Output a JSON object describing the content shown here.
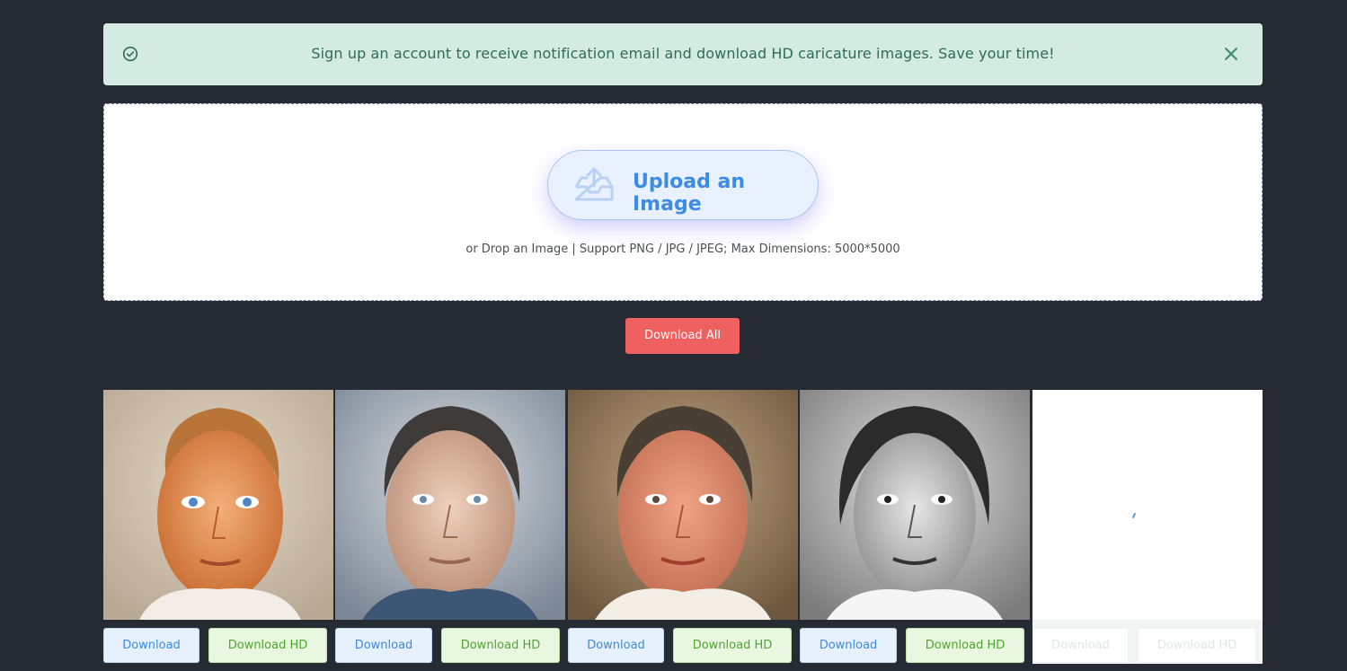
{
  "alert": {
    "message": "Sign up an account to receive notification email and download HD caricature images. Save your time!"
  },
  "upload": {
    "button_label": "Upload an Image",
    "hint": "or Drop an Image | Support PNG / JPG / JPEG; Max Dimensions: 5000*5000"
  },
  "actions": {
    "download_all_label": "Download All"
  },
  "results": [
    {
      "download_label": "Download",
      "download_hd_label": "Download HD",
      "style": "warm-color"
    },
    {
      "download_label": "Download",
      "download_hd_label": "Download HD",
      "style": "cool-blue"
    },
    {
      "download_label": "Download",
      "download_hd_label": "Download HD",
      "style": "sepia-warm"
    },
    {
      "download_label": "Download",
      "download_hd_label": "Download HD",
      "style": "grayscale-sketch"
    },
    {
      "download_label": "Download",
      "download_hd_label": "Download HD",
      "style": "loading"
    }
  ],
  "colors": {
    "background": "#252a33",
    "alert_bg": "#d3ebe1",
    "alert_text": "#2f6b58",
    "upload_accent": "#3c8ce6",
    "download_all_bg": "#ef6160",
    "download_button": "#3d8ae0",
    "download_hd_button": "#4fa62e"
  }
}
